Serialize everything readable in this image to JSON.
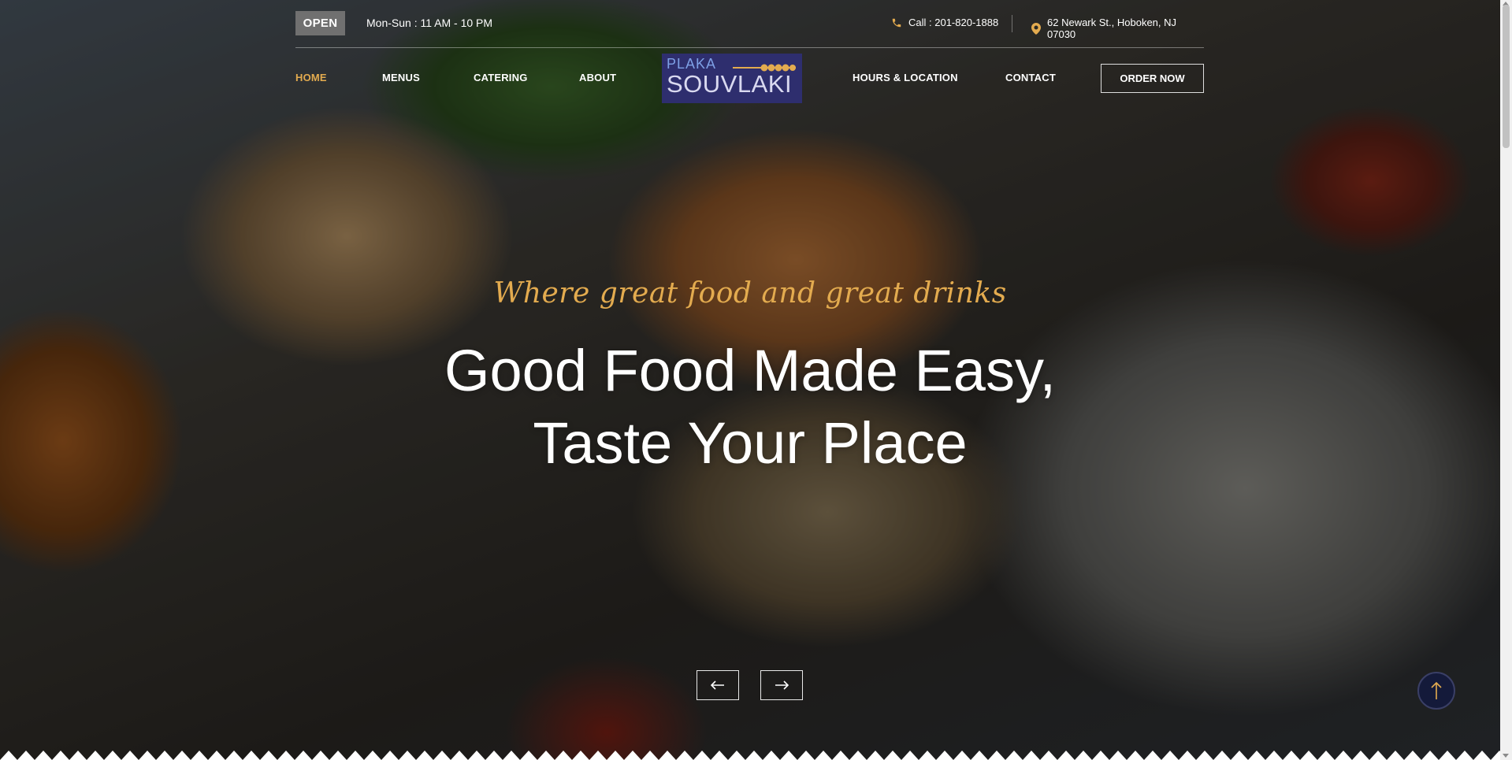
{
  "topbar": {
    "open_badge": "OPEN",
    "hours": "Mon-Sun : 11 AM - 10 PM",
    "call": "Call : 201-820-1888",
    "address": "62 Newark St., Hoboken, NJ 07030",
    "phone_icon": "phone-icon",
    "location_icon": "location-pin-icon"
  },
  "nav": {
    "items": [
      "HOME",
      "MENUS",
      "CATERING",
      "ABOUT",
      "HOURS & LOCATION",
      "CONTACT"
    ],
    "active": "HOME",
    "order_button": "ORDER NOW"
  },
  "logo": {
    "line1": "PLAKA",
    "line2": "SOUVLAKI"
  },
  "hero": {
    "tagline": "Where great food and great drinks",
    "headline_line1": "Good Food Made Easy,",
    "headline_line2": "Taste Your Place",
    "prev_icon": "arrow-left-icon",
    "next_icon": "arrow-right-icon"
  },
  "colors": {
    "accent": "#e3ab4f",
    "logo_bg": "#2e2e6e",
    "open_badge_bg": "#707070",
    "back_to_top_bg": "#141a3a"
  }
}
